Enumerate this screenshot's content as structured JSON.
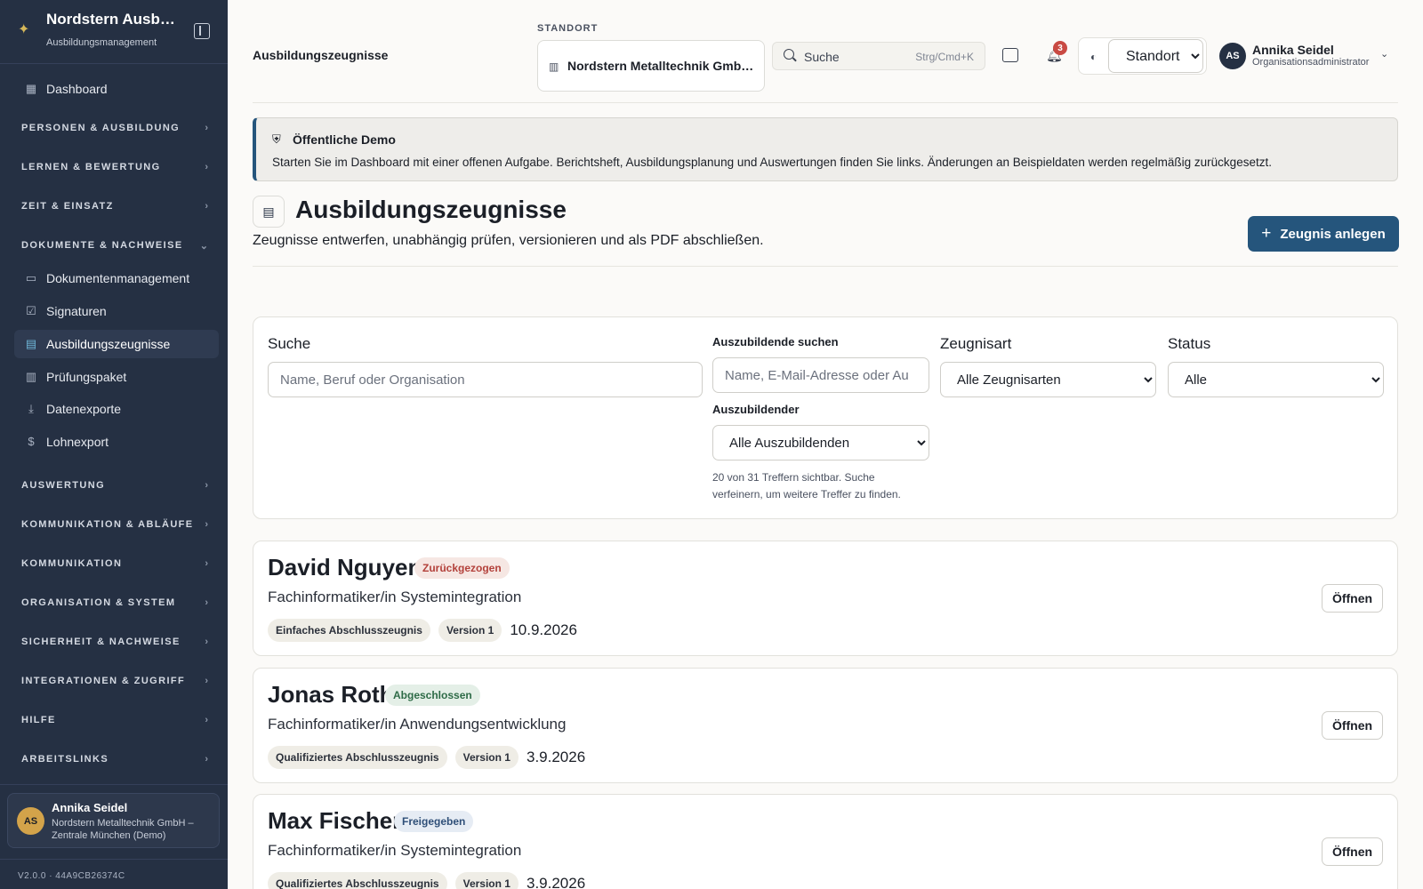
{
  "sidebar": {
    "brand_title": "Nordstern Ausbildung",
    "brand_subtitle": "Ausbildungsmanagement",
    "items": {
      "dashboard": "Dashboard",
      "dokumentenmanagement": "Dokumentenmanagement",
      "signaturen": "Signaturen",
      "ausbildungszeugnisse": "Ausbildungszeugnisse",
      "pruefungspaket": "Prüfungspaket",
      "datenexporte": "Datenexporte",
      "lohnexport": "Lohnexport"
    },
    "sections": {
      "personen": "PERSONEN & AUSBILDUNG",
      "lernen": "LERNEN & BEWERTUNG",
      "zeit": "ZEIT & EINSATZ",
      "dokumente": "DOKUMENTE & NACHWEISE",
      "auswertung": "AUSWERTUNG",
      "kommunikation_ablaeufe": "KOMMUNIKATION & ABLÄUFE",
      "kommunikation": "KOMMUNIKATION",
      "organisation": "ORGANISATION & SYSTEM",
      "sicherheit": "SICHERHEIT & NACHWEISE",
      "integrationen": "INTEGRATIONEN & ZUGRIFF",
      "hilfe": "HILFE",
      "arbeitslinks": "ARBEITSLINKS"
    },
    "user": {
      "initials": "AS",
      "name": "Annika Seidel",
      "org": "Nordstern Metalltechnik GmbH – Zentrale München (Demo)"
    },
    "version": "V2.0.0 · 44A9CB26374C"
  },
  "header": {
    "title": "Ausbildungszeugnisse",
    "location_label": "STANDORT",
    "location_value": "Nordstern Metalltechnik GmbH – Zentrale München",
    "search_placeholder": "Suche",
    "search_shortcut": "Strg/Cmd+K",
    "notification_count": "3",
    "standort_select": "Standort",
    "user_initials": "AS",
    "user_name": "Annika Seidel",
    "user_role": "Organisationsadministrator"
  },
  "banner": {
    "title": "Öffentliche Demo",
    "text": "Starten Sie im Dashboard mit einer offenen Aufgabe. Berichtsheft, Ausbildungsplanung und Auswertungen finden Sie links. Änderungen an Beispieldaten werden regelmäßig zurückgesetzt."
  },
  "page": {
    "title": "Ausbildungszeugnisse",
    "subtitle": "Zeugnisse entwerfen, unabhängig prüfen, versionieren und als PDF abschließen.",
    "add_button": "Zeugnis anlegen"
  },
  "filters": {
    "search_label": "Suche",
    "search_placeholder": "Name, Beruf oder Organisation",
    "trainee_search_label": "Auszubildende suchen",
    "trainee_search_placeholder": "Name, E-Mail-Adresse oder Au",
    "trainee_label": "Auszubildender",
    "trainee_value": "Alle Auszubildenden",
    "type_label": "Zeugnisart",
    "type_value": "Alle Zeugnisarten",
    "status_label": "Status",
    "status_value": "Alle",
    "hits_text": "20 von 31 Treffern sichtbar. Suche verfeinern, um weitere Treffer zu finden."
  },
  "results": [
    {
      "name": "David Nguyen",
      "status": "Zurückgezogen",
      "job": "Fachinformatiker/in Systemintegration",
      "type": "Einfaches Abschlusszeugnis",
      "version": "Version 1",
      "date": "10.9.2026",
      "open": "Öffnen"
    },
    {
      "name": "Jonas Roth",
      "status": "Abgeschlossen",
      "job": "Fachinformatiker/in Anwendungsentwicklung",
      "type": "Qualifiziertes Abschlusszeugnis",
      "version": "Version 1",
      "date": "3.9.2026",
      "open": "Öffnen"
    },
    {
      "name": "Max Fischer",
      "status": "Freigegeben",
      "job": "Fachinformatiker/in Systemintegration",
      "type": "Qualifiziertes Abschlusszeugnis",
      "version": "Version 1",
      "date": "3.9.2026",
      "open": "Öffnen"
    }
  ],
  "colors": {
    "sidebar_bg": "#253043",
    "accent": "#25557c",
    "status_withdrawn": "#b3413b",
    "status_completed": "#2e6b47",
    "status_released": "#2f4f78"
  },
  "icons": {
    "brand": "sparkle-icon",
    "collapse": "sidebar-collapse-icon",
    "dashboard": "grid-icon",
    "documents": "folder-icon",
    "signatures": "checkbox-icon",
    "certificates": "file-certificate-icon",
    "exam_package": "building-icon",
    "exports": "download-icon",
    "payroll": "dollar-icon",
    "search": "search-icon",
    "messages": "chat-icon",
    "notifications": "bell-icon",
    "theme": "palette-icon",
    "banner": "shield-check-icon",
    "add": "plus-icon"
  }
}
